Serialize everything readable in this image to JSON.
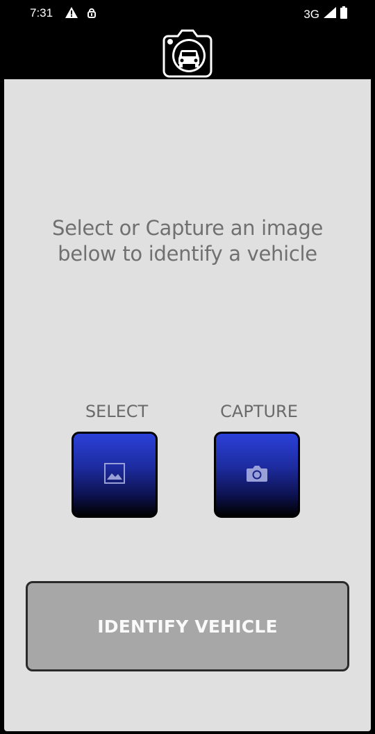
{
  "status_bar": {
    "time": "7:31",
    "network": "3G",
    "icons_left": [
      "warning-icon",
      "vpn-key-icon"
    ],
    "icons_right": [
      "signal-icon",
      "battery-icon"
    ]
  },
  "header": {
    "logo": "camera-car-logo-icon"
  },
  "main": {
    "instruction": "Select or Capture an image below to identify a vehicle",
    "select": {
      "label": "SELECT",
      "icon": "image-icon"
    },
    "capture": {
      "label": "CAPTURE",
      "icon": "camera-icon"
    },
    "identify_button": {
      "label": "IDENTIFY VEHICLE"
    }
  },
  "colors": {
    "accent_top": "#2b40d8",
    "accent_bottom": "#000000",
    "background": "#e0e0e0",
    "button_disabled": "#a8a7a8"
  }
}
